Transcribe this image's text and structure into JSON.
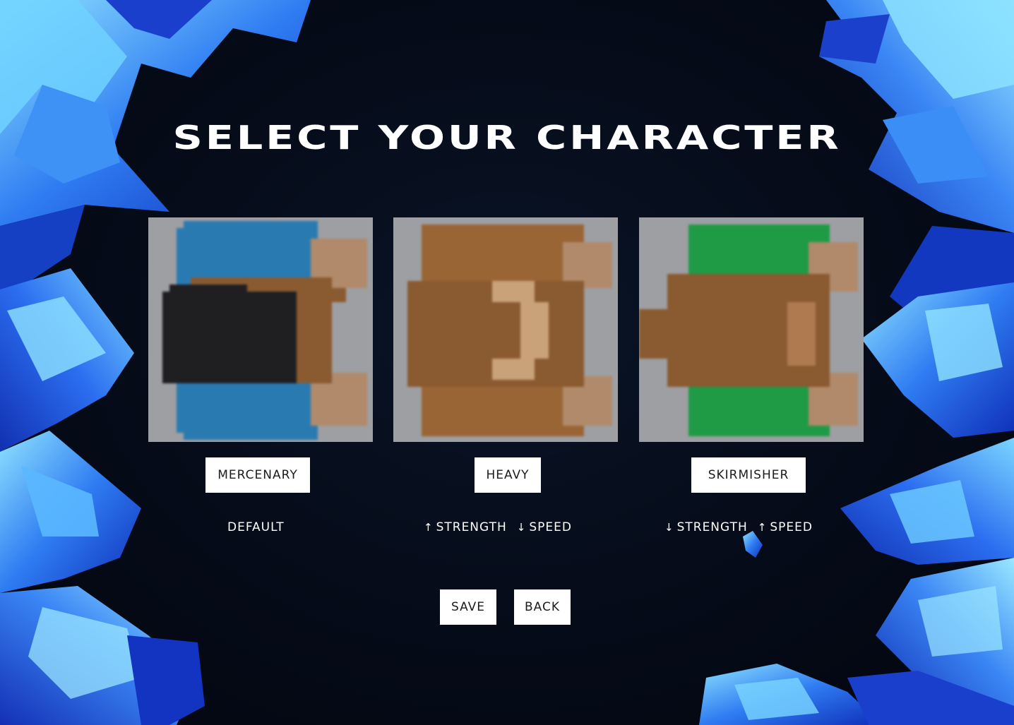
{
  "screen": {
    "title": "SELECT YOUR CHARACTER"
  },
  "characters": [
    {
      "name": "MERCENARY",
      "stats": [
        {
          "arrow": "",
          "label": "DEFAULT"
        }
      ],
      "colors": {
        "shirt": "#2a7ab2",
        "hair": "#1f1f22",
        "skin": "#8a5a30",
        "hands": "#b08a6a"
      }
    },
    {
      "name": "HEAVY",
      "stats": [
        {
          "arrow": "↑",
          "label": "STRENGTH"
        },
        {
          "arrow": "↓",
          "label": "SPEED"
        }
      ],
      "colors": {
        "shirt": "#9a6535",
        "hair": "#8a5a30",
        "skin": "#8a5a30",
        "hands": "#b08a6a"
      }
    },
    {
      "name": "SKIRMISHER",
      "stats": [
        {
          "arrow": "↓",
          "label": "STRENGTH"
        },
        {
          "arrow": "↑",
          "label": "SPEED"
        }
      ],
      "colors": {
        "shirt": "#1f9a45",
        "hair": "#8a5a30",
        "skin": "#8a5a30",
        "hands": "#b08a6a"
      }
    }
  ],
  "actions": {
    "save_label": "SAVE",
    "back_label": "BACK"
  },
  "theme": {
    "background": "#050a16",
    "crystal_dark": "#1238c9",
    "crystal_mid": "#2a6ff0",
    "crystal_light": "#6fd0ff",
    "card_bg": "#9e9fa3",
    "button_bg": "#ffffff"
  }
}
